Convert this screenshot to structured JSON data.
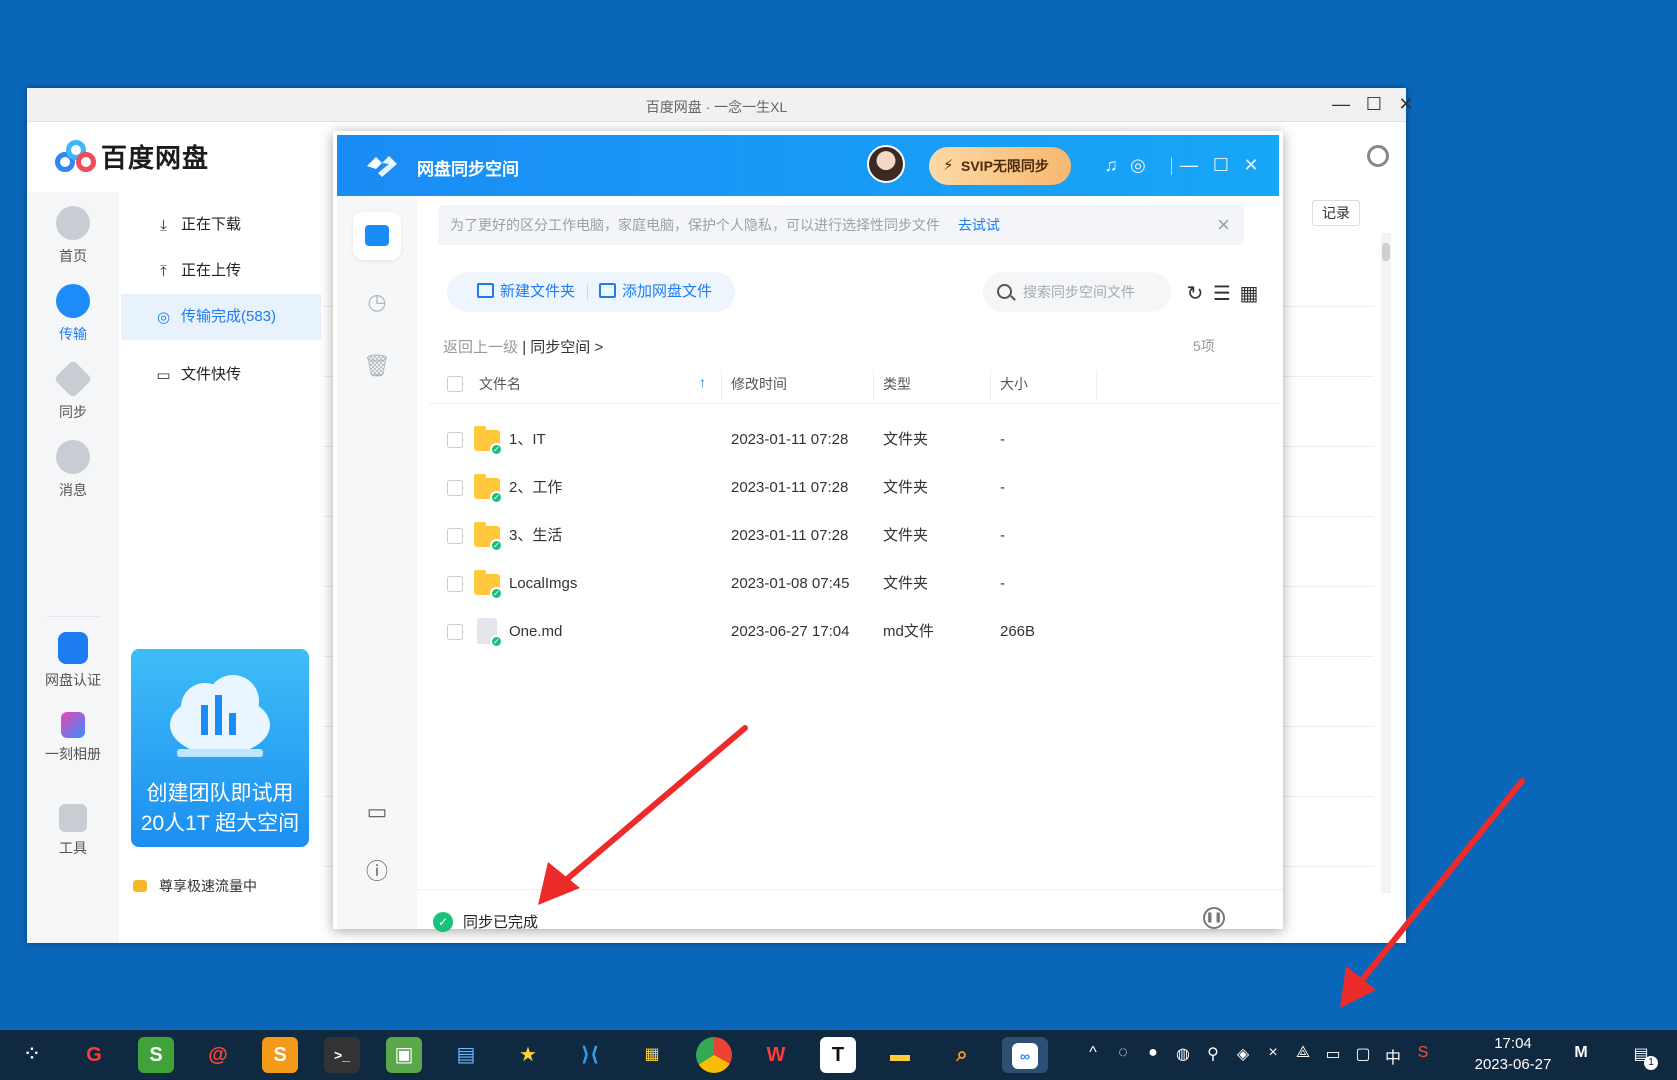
{
  "main_window": {
    "title": "百度网盘 · 一念一生XL",
    "logo_text": "百度网盘",
    "nav": [
      {
        "label": "首页",
        "icon": "cloud-icon"
      },
      {
        "label": "传输",
        "icon": "transfer-icon"
      },
      {
        "label": "同步",
        "icon": "sync-icon"
      },
      {
        "label": "消息",
        "icon": "message-icon"
      },
      {
        "label": "网盘认证",
        "icon": "verify-icon"
      },
      {
        "label": "一刻相册",
        "icon": "album-icon"
      },
      {
        "label": "工具",
        "icon": "tools-icon"
      }
    ],
    "subnav": [
      {
        "label": "正在下载",
        "icon": "download-icon"
      },
      {
        "label": "正在上传",
        "icon": "upload-icon"
      },
      {
        "label": "传输完成(583)",
        "icon": "check-circle-icon"
      },
      {
        "label": "文件快传",
        "icon": "monitor-icon"
      }
    ],
    "promo": {
      "line1": "创建团队即试用",
      "line2": "20人1T 超大空间"
    },
    "speed_text": "尊享极速流量中",
    "record_button": "记录",
    "accent": "#1e7cf0"
  },
  "sync_window": {
    "title": "网盘同步空间",
    "svip_label": "SVIP无限同步",
    "tip_text": "为了更好的区分工作电脑，家庭电脑，保护个人隐私，可以进行选择性同步文件",
    "tip_link": "去试试",
    "new_folder": "新建文件夹",
    "add_files": "添加网盘文件",
    "search_placeholder": "搜索同步空间文件",
    "breadcrumb_back": "返回上一级",
    "breadcrumb_current": "同步空间",
    "item_count": "5项",
    "columns": {
      "name": "文件名",
      "modified": "修改时间",
      "type": "类型",
      "size": "大小"
    },
    "files": [
      {
        "name": "1、IT",
        "modified": "2023-01-11 07:28",
        "type": "文件夹",
        "size": "-",
        "kind": "folder"
      },
      {
        "name": "2、工作",
        "modified": "2023-01-11 07:28",
        "type": "文件夹",
        "size": "-",
        "kind": "folder"
      },
      {
        "name": "3、生活",
        "modified": "2023-01-11 07:28",
        "type": "文件夹",
        "size": "-",
        "kind": "folder"
      },
      {
        "name": "LocalImgs",
        "modified": "2023-01-08 07:45",
        "type": "文件夹",
        "size": "-",
        "kind": "folder"
      },
      {
        "name": "One.md",
        "modified": "2023-06-27 17:04",
        "type": "md文件",
        "size": "266B",
        "kind": "file"
      }
    ],
    "status_text": "同步已完成",
    "header_color": "#1a8cf5",
    "ok_color": "#19c27a"
  },
  "taskbar": {
    "ime_label": "中",
    "clock_time": "17:04",
    "clock_date": "2023-06-27",
    "notification_badge": "1"
  }
}
